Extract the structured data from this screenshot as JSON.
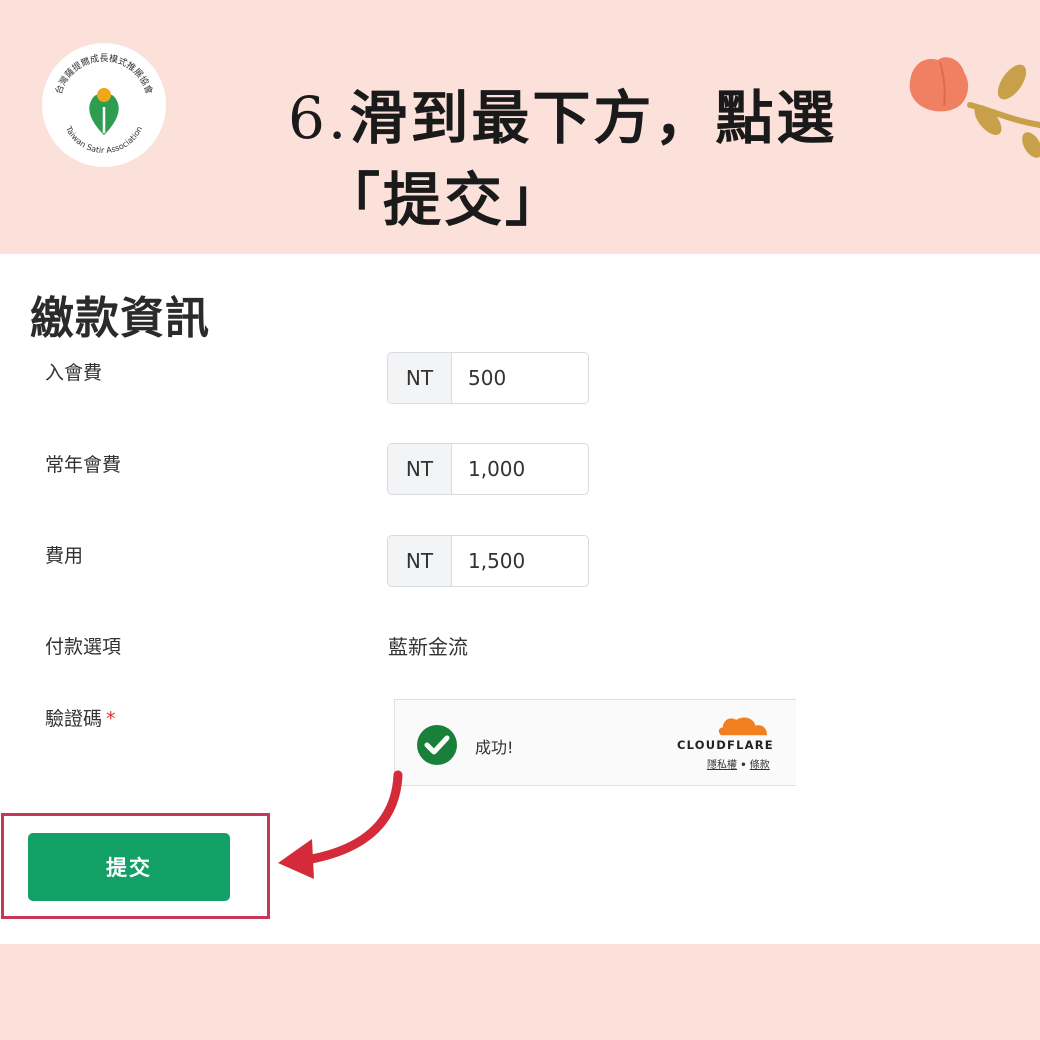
{
  "banner": {
    "title_line1_num": "6.",
    "title_line1_text": "滑到最下方，點選",
    "title_line2": "「提交」",
    "logo_name_zh": "台灣薩提爾成長模式推展協會",
    "logo_name_en": "Taiwan Satir Association"
  },
  "form": {
    "section_title": "繳款資訊",
    "rows": [
      {
        "label": "入會費",
        "prefix": "NT",
        "value": "500"
      },
      {
        "label": "常年會費",
        "prefix": "NT",
        "value": "1,000"
      },
      {
        "label": "費用",
        "prefix": "NT",
        "value": "1,500"
      }
    ],
    "payment": {
      "label": "付款選項",
      "value": "藍新金流"
    },
    "captcha": {
      "label": "驗證碼",
      "required_mark": "*",
      "status": "成功!",
      "brand": "CLOUDFLARE",
      "link_privacy": "隱私權",
      "link_sep": "•",
      "link_terms": "條款"
    },
    "submit_label": "提交"
  },
  "colors": {
    "background": "#fbe1da",
    "submit": "#13a067",
    "highlight": "#c8375a",
    "arrow": "#d42a3a",
    "cloudflare": "#f38020"
  }
}
